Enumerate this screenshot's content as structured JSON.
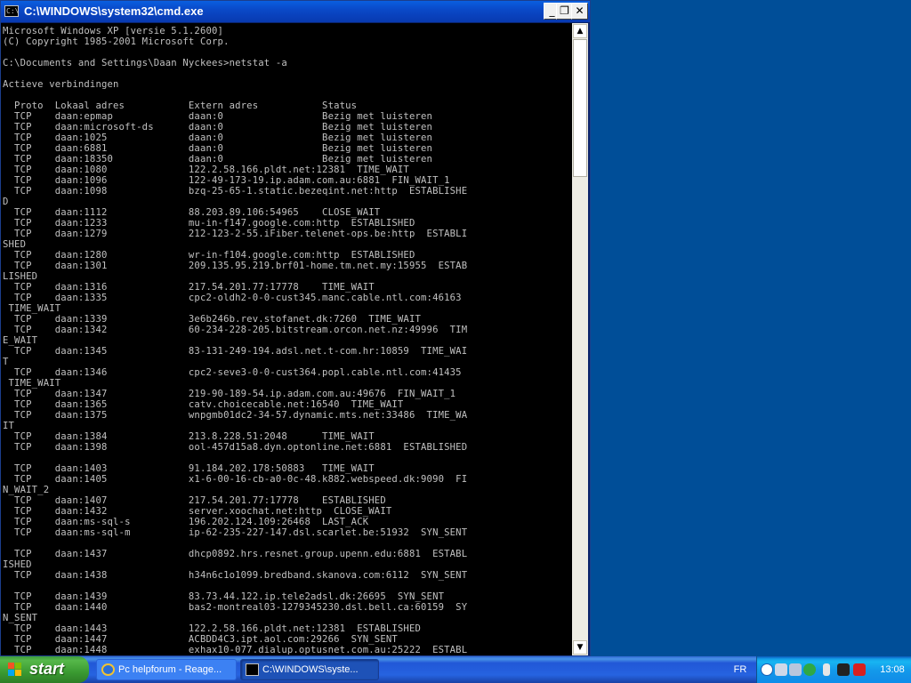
{
  "window": {
    "title": "C:\\WINDOWS\\system32\\cmd.exe",
    "minimize_glyph": "_",
    "maximize_glyph": "❐",
    "close_glyph": "✕",
    "console_output": "Microsoft Windows XP [versie 5.1.2600]\n(C) Copyright 1985-2001 Microsoft Corp.\n\nC:\\Documents and Settings\\Daan Nyckees>netstat -a\n\nActieve verbindingen\n\n  Proto  Lokaal adres           Extern adres           Status\n  TCP    daan:epmap             daan:0                 Bezig met luisteren\n  TCP    daan:microsoft-ds      daan:0                 Bezig met luisteren\n  TCP    daan:1025              daan:0                 Bezig met luisteren\n  TCP    daan:6881              daan:0                 Bezig met luisteren\n  TCP    daan:18350             daan:0                 Bezig met luisteren\n  TCP    daan:1080              122.2.58.166.pldt.net:12381  TIME_WAIT\n  TCP    daan:1096              122-49-173-19.ip.adam.com.au:6881  FIN_WAIT_1\n  TCP    daan:1098              bzq-25-65-1.static.bezeqint.net:http  ESTABLISHE\nD\n  TCP    daan:1112              88.203.89.106:54965    CLOSE_WAIT\n  TCP    daan:1233              mu-in-f147.google.com:http  ESTABLISHED\n  TCP    daan:1279              212-123-2-55.iFiber.telenet-ops.be:http  ESTABLI\nSHED\n  TCP    daan:1280              wr-in-f104.google.com:http  ESTABLISHED\n  TCP    daan:1301              209.135.95.219.brf01-home.tm.net.my:15955  ESTAB\nLISHED\n  TCP    daan:1316              217.54.201.77:17778    TIME_WAIT\n  TCP    daan:1335              cpc2-oldh2-0-0-cust345.manc.cable.ntl.com:46163\n TIME_WAIT\n  TCP    daan:1339              3e6b246b.rev.stofanet.dk:7260  TIME_WAIT\n  TCP    daan:1342              60-234-228-205.bitstream.orcon.net.nz:49996  TIM\nE_WAIT\n  TCP    daan:1345              83-131-249-194.adsl.net.t-com.hr:10859  TIME_WAI\nT\n  TCP    daan:1346              cpc2-seve3-0-0-cust364.popl.cable.ntl.com:41435\n TIME_WAIT\n  TCP    daan:1347              219-90-189-54.ip.adam.com.au:49676  FIN_WAIT_1\n  TCP    daan:1365              catv.choicecable.net:16540  TIME_WAIT\n  TCP    daan:1375              wnpgmb01dc2-34-57.dynamic.mts.net:33486  TIME_WA\nIT\n  TCP    daan:1384              213.8.228.51:2048      TIME_WAIT\n  TCP    daan:1398              ool-457d15a8.dyn.optonline.net:6881  ESTABLISHED\n\n  TCP    daan:1403              91.184.202.178:50883   TIME_WAIT\n  TCP    daan:1405              x1-6-00-16-cb-a0-0c-48.k882.webspeed.dk:9090  FI\nN_WAIT_2\n  TCP    daan:1407              217.54.201.77:17778    ESTABLISHED\n  TCP    daan:1432              server.xoochat.net:http  CLOSE_WAIT\n  TCP    daan:ms-sql-s          196.202.124.109:26468  LAST_ACK\n  TCP    daan:ms-sql-m          ip-62-235-227-147.dsl.scarlet.be:51932  SYN_SENT\n\n  TCP    daan:1437              dhcp0892.hrs.resnet.group.upenn.edu:6881  ESTABL\nISHED\n  TCP    daan:1438              h34n6c1o1099.bredband.skanova.com:6112  SYN_SENT\n\n  TCP    daan:1439              83.73.44.122.ip.tele2adsl.dk:26695  SYN_SENT\n  TCP    daan:1440              bas2-montreal03-1279345230.dsl.bell.ca:60159  SY\nN_SENT\n  TCP    daan:1443              122.2.58.166.pldt.net:12381  ESTABLISHED\n  TCP    daan:1447              ACBDD4C3.ipt.aol.com:29266  SYN_SENT\n  TCP    daan:1448              exhax10-077.dialup.optusnet.com.au:25222  ESTABL"
  },
  "scrollbar": {
    "up_glyph": "▲",
    "down_glyph": "▼"
  },
  "taskbar": {
    "start_label": "start",
    "tasks": [
      {
        "label": "Pc helpforum - Reage...",
        "icon": "internet-explorer-icon"
      },
      {
        "label": "C:\\WINDOWS\\syste...",
        "icon": "cmd-icon"
      }
    ],
    "language": "FR",
    "clock": "13:08"
  },
  "colors": {
    "console_bg": "#000000",
    "console_text": "#c0c0c0",
    "titlebar": "#0a49c8",
    "desktop": "#004e98",
    "taskbar": "#2663e0",
    "start_button": "#3a9a31",
    "tray": "#139beb"
  }
}
